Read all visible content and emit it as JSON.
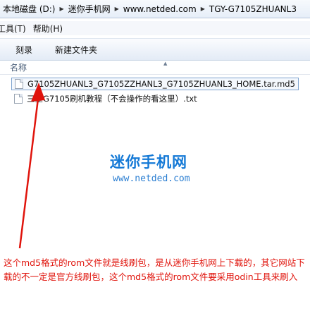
{
  "breadcrumb": [
    "本地磁盘 (D:)",
    "迷你手机网",
    "www.netded.com",
    "TGY-G7105ZHUANL3"
  ],
  "menu": [
    "工具(T)",
    "帮助(H)"
  ],
  "toolbar": {
    "burn": "刻录",
    "new_folder": "新建文件夹"
  },
  "columns": {
    "name": "名称"
  },
  "files": [
    {
      "name": "G7105ZHUANL3_G7105ZZHANL3_G7105ZHUANL3_HOME.tar.md5",
      "selected": true
    },
    {
      "name": "三星G7105刷机教程（不会操作的看这里）.txt",
      "selected": false
    }
  ],
  "watermark": {
    "logo": "迷你手机网",
    "url": "www.netded.com"
  },
  "annotation": {
    "color": "#e0140c",
    "text": "这个md5格式的rom文件就是线刷包，是从迷你手机网上下载的，其它网站下载的不一定是官方线刷包，这个md5格式的rom文件要采用odin工具来刷入"
  }
}
